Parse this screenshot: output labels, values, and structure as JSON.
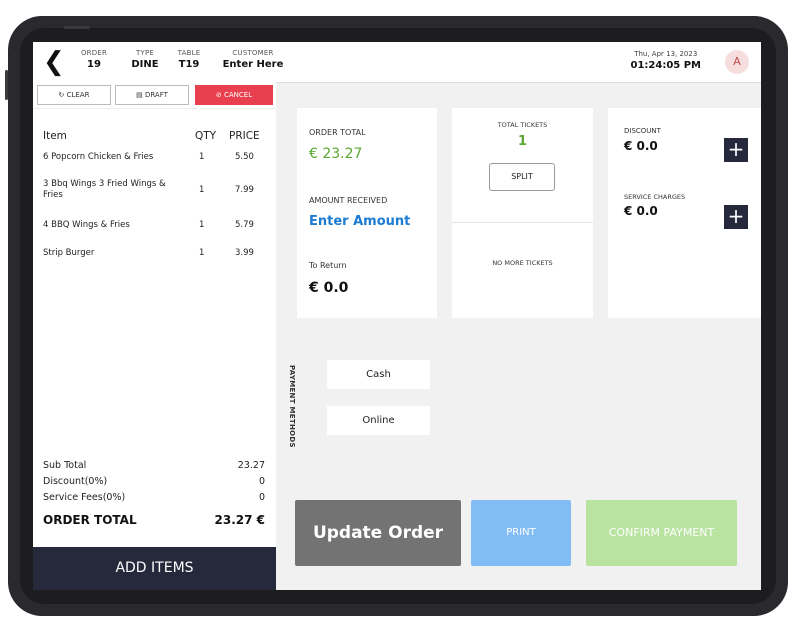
{
  "header": {
    "order": {
      "label": "ORDER",
      "value": "19"
    },
    "type": {
      "label": "TYPE",
      "value": "DINE"
    },
    "table": {
      "label": "TABLE",
      "value": "T19"
    },
    "customer": {
      "label": "CUSTOMER",
      "value": "Enter Here"
    },
    "date": "Thu, Apr 13, 2023",
    "time": "01:24:05 PM",
    "avatar": "A"
  },
  "toolbar": {
    "clear": "CLEAR",
    "draft": "DRAFT",
    "cancel": "CANCEL"
  },
  "items_header": {
    "item": "Item",
    "qty": "QTY",
    "price": "PRICE"
  },
  "items": [
    {
      "name": "6 Popcorn Chicken & Fries",
      "qty": "1",
      "price": "5.50"
    },
    {
      "name": "3 Bbq Wings 3 Fried Wings & Fries",
      "qty": "1",
      "price": "7.99"
    },
    {
      "name": "4 BBQ Wings & Fries",
      "qty": "1",
      "price": "5.79"
    },
    {
      "name": "Strip Burger",
      "qty": "1",
      "price": "3.99"
    }
  ],
  "summary": {
    "subtotal_label": "Sub Total",
    "subtotal": "23.27",
    "discount_label": "Discount(0%)",
    "discount": "0",
    "service_label": "Service Fees(0%)",
    "service": "0",
    "total_label": "ORDER TOTAL",
    "total": "23.27 €"
  },
  "add_items": "ADD ITEMS",
  "payment": {
    "order_total_label": "ORDER TOTAL",
    "order_total": "€ 23.27",
    "amount_received_label": "AMOUNT RECEIVED",
    "amount_received": "Enter Amount",
    "to_return_label": "To Return",
    "to_return": "€ 0.0"
  },
  "tickets": {
    "label": "TOTAL TICKETS",
    "count": "1",
    "split": "SPLIT",
    "no_more": "NO MORE TICKETS"
  },
  "charges": {
    "discount_label": "DISCOUNT",
    "discount": "€ 0.0",
    "service_label": "SERVICE CHARGES",
    "service": "€ 0.0"
  },
  "payment_methods": {
    "label": "PAYMENT METHODS",
    "cash": "Cash",
    "online": "Online"
  },
  "actions": {
    "update": "Update Order",
    "print": "PRINT",
    "confirm": "CONFIRM PAYMENT"
  },
  "colors": {
    "cancel": "#e8404e",
    "dark": "#26293b",
    "update": "#737373",
    "print": "#82bcf5",
    "confirm": "#b9e3a0",
    "green": "#5ba830",
    "blue": "#1c7bd3"
  }
}
